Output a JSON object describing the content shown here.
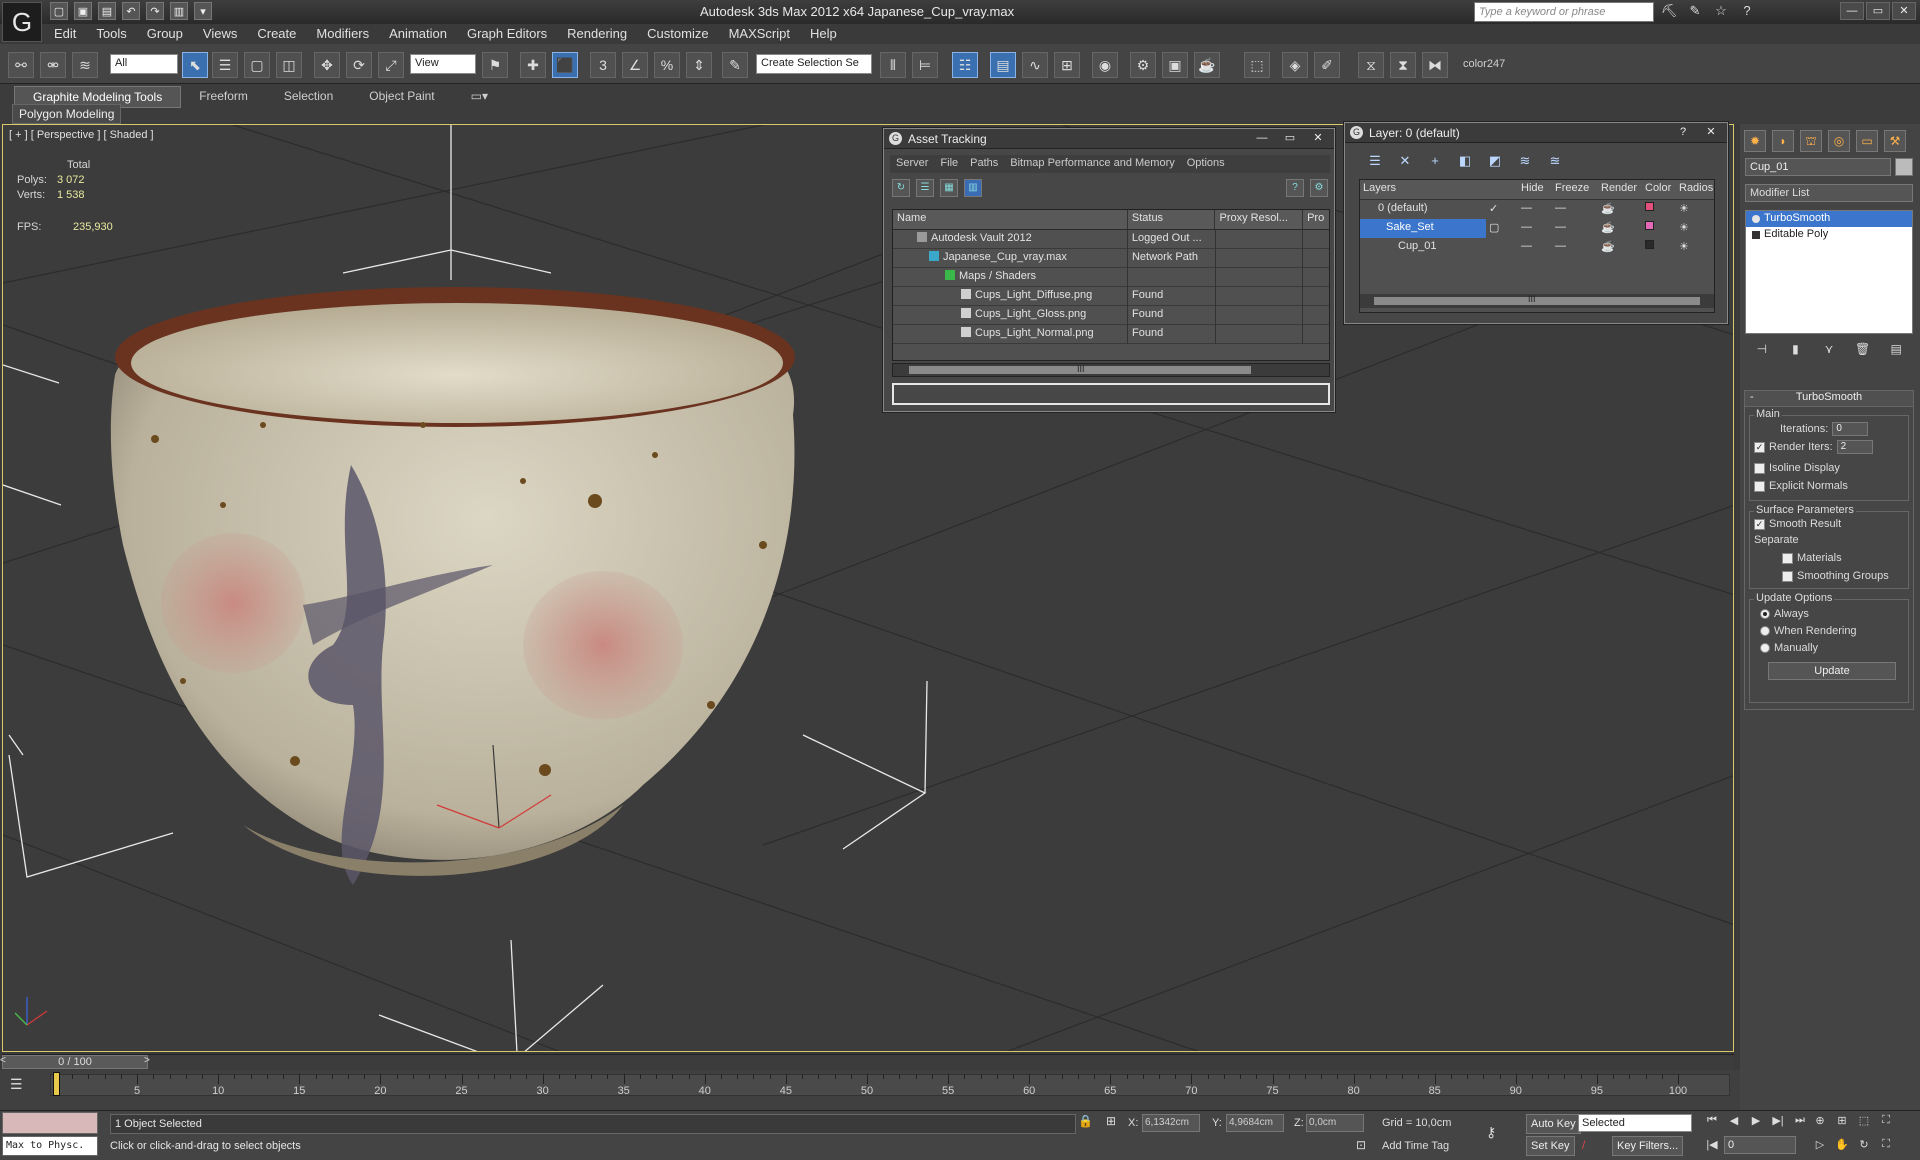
{
  "titlebar": {
    "app_title": "Autodesk 3ds Max  2012 x64     Japanese_Cup_vray.max",
    "search_placeholder": "Type a keyword or phrase",
    "logo_glyph": "G",
    "quick_access": [
      "▢",
      "▣",
      "▤",
      "↶",
      "↷",
      "▥",
      "▾"
    ],
    "icons": [
      "⛏",
      "✎",
      "☆",
      "?"
    ],
    "window_buttons": [
      "—",
      "▭",
      "✕"
    ]
  },
  "menu": [
    "Edit",
    "Tools",
    "Group",
    "Views",
    "Create",
    "Modifiers",
    "Animation",
    "Graph Editors",
    "Rendering",
    "Customize",
    "MAXScript",
    "Help"
  ],
  "toolbar": {
    "filter_select": "All",
    "view_select": "View",
    "named_selection": "Create Selection Se",
    "color_label": "color247"
  },
  "ribbon": {
    "tabs": [
      "Graphite Modeling Tools",
      "Freeform",
      "Selection",
      "Object Paint"
    ],
    "active_tab": 0,
    "sub_panel": "Polygon Modeling"
  },
  "viewport": {
    "label": "[ + ] [ Perspective ] [ Shaded ]",
    "stats": {
      "total_label": "Total",
      "polys_label": "Polys:",
      "polys_value": "3 072",
      "verts_label": "Verts:",
      "verts_value": "1 538",
      "fps_label": "FPS:",
      "fps_value": "235,930"
    },
    "axis_labels": [
      "z",
      "x",
      "y"
    ]
  },
  "asset_tracking": {
    "title": "Asset Tracking",
    "menu": [
      "Server",
      "File",
      "Paths",
      "Bitmap Performance and Memory",
      "Options"
    ],
    "columns": [
      "Name",
      "Status",
      "Proxy Resol...",
      "Pro"
    ],
    "rows": [
      {
        "name": "Autodesk Vault 2012",
        "status": "Logged Out ...",
        "indent": 0
      },
      {
        "name": "Japanese_Cup_vray.max",
        "status": "Network Path",
        "indent": 1
      },
      {
        "name": "Maps / Shaders",
        "status": "",
        "indent": 2
      },
      {
        "name": "Cups_Light_Diffuse.png",
        "status": "Found",
        "indent": 3
      },
      {
        "name": "Cups_Light_Gloss.png",
        "status": "Found",
        "indent": 3
      },
      {
        "name": "Cups_Light_Normal.png",
        "status": "Found",
        "indent": 3
      }
    ],
    "scroll_mark": "III"
  },
  "layer_window": {
    "title": "Layer: 0 (default)",
    "buttons": [
      "?",
      "✕"
    ],
    "columns": [
      "Layers",
      "",
      "Hide",
      "Freeze",
      "Render",
      "Color",
      "Radios"
    ],
    "rows": [
      {
        "name": "0 (default)",
        "current": "✓",
        "color": "#e0507a",
        "selected": false
      },
      {
        "name": "Sake_Set",
        "current": "",
        "color": "#e46ab8",
        "selected": true
      },
      {
        "name": "Cup_01",
        "current": "",
        "color": "#2a2a2a",
        "selected": false
      }
    ],
    "scroll_mark": "III"
  },
  "command_panel": {
    "object_name": "Cup_01",
    "modifier_list": "Modifier List",
    "stack": [
      "TurboSmooth",
      "Editable Poly"
    ],
    "selected_stack": 0,
    "rollout_title": "TurboSmooth",
    "main_group": "Main",
    "iterations_label": "Iterations:",
    "iterations_value": "0",
    "render_iters_label": "Render Iters:",
    "render_iters_value": "2",
    "render_iters_checked": true,
    "isoline_label": "Isoline Display",
    "explicit_normals_label": "Explicit Normals",
    "surface_group": "Surface Parameters",
    "smooth_result_label": "Smooth Result",
    "separate_label": "Separate",
    "materials_label": "Materials",
    "smoothing_groups_label": "Smoothing Groups",
    "update_group": "Update Options",
    "always_label": "Always",
    "when_rendering_label": "When Rendering",
    "manually_label": "Manually",
    "update_button": "Update"
  },
  "timeline": {
    "position_label": "0 / 100",
    "ticks": [
      5,
      10,
      15,
      20,
      25,
      30,
      35,
      40,
      45,
      50,
      55,
      60,
      65,
      70,
      75,
      80,
      85,
      90,
      95,
      100
    ]
  },
  "status": {
    "maxscript": "Max to Physc.",
    "selection": "1 Object Selected",
    "prompt": "Click or click-and-drag to select objects",
    "x_label": "X:",
    "x_value": "6,1342cm",
    "y_label": "Y:",
    "y_value": "4,9684cm",
    "z_label": "Z:",
    "z_value": "0,0cm",
    "grid": "Grid = 10,0cm",
    "add_time_tag": "Add Time Tag",
    "auto_key": "Auto Key",
    "set_key": "Set Key",
    "key_select": "Selected",
    "key_filters": "Key Filters...",
    "frame": "0"
  }
}
